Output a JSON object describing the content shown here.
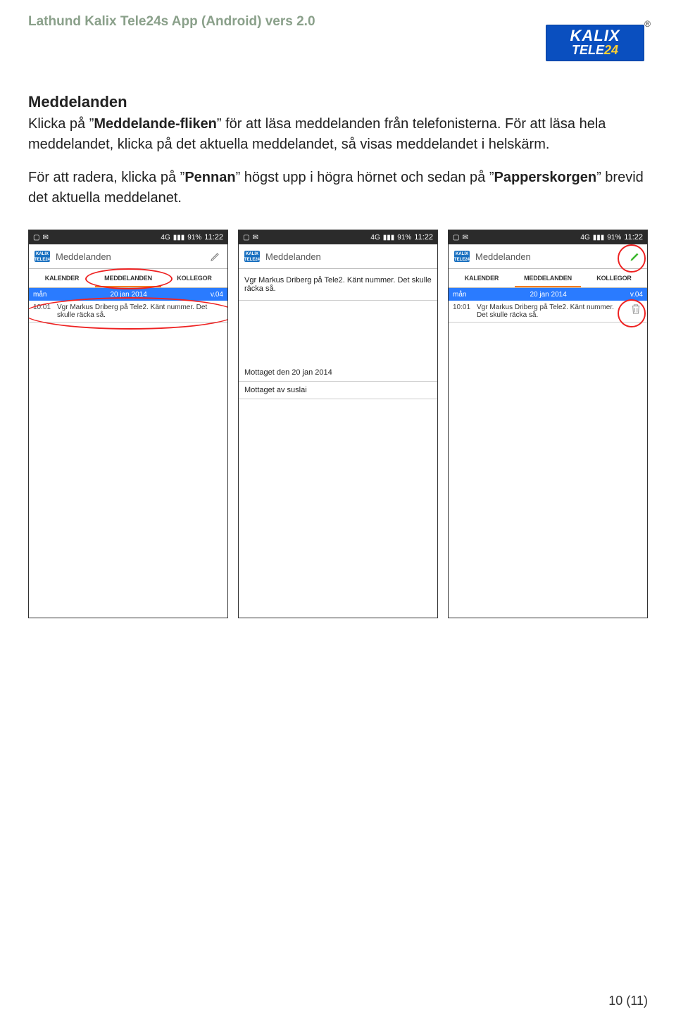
{
  "doc_header": "Lathund Kalix Tele24s App (Android) vers 2.0",
  "logo": {
    "top": "KALIX",
    "bot_prefix": "TELE",
    "bot_yellow": "24",
    "reg": "®"
  },
  "section_title": "Meddelanden",
  "para1_pre": "Klicka på ”",
  "para1_bold": "Meddelande-fliken",
  "para1_post": "” för att läsa meddelanden från telefonisterna. För att läsa hela meddelandet, klicka på det aktuella meddelandet, så visas meddelandet i helskärm.",
  "para2_pre": "För att radera, klicka på ”",
  "para2_b1": "Pennan",
  "para2_mid": "” högst upp i högra hörnet och sedan på ”",
  "para2_b2": "Papperskorgen",
  "para2_post": "” brevid det aktuella meddelanet.",
  "status": {
    "net": "4G",
    "sig": "▮▮▮",
    "bat": "91%",
    "time": "11:22"
  },
  "app": {
    "icon_text": "KALIX\nTELE24",
    "title": "Meddelanden"
  },
  "tabs": {
    "kal": "KALENDER",
    "med": "MEDDELANDEN",
    "kol": "KOLLEGOR"
  },
  "daterow": {
    "day": "mån",
    "date": "20 jan 2014",
    "wk": "v.04"
  },
  "msg": {
    "time": "10:01",
    "text_short": "Vgr Markus Driberg på Tele2. Känt nummer. Det skulle räcka så.",
    "text_wrap": "Vgr Markus Driberg på Tele2. Känt nummer. Det skulle räcka så."
  },
  "detail": {
    "msg": "Vgr Markus Driberg på Tele2. Känt nummer. Det skulle räcka så.",
    "received": "Mottaget den 20 jan 2014",
    "by": "Mottaget av suslai"
  },
  "pagenum": "10 (11)"
}
